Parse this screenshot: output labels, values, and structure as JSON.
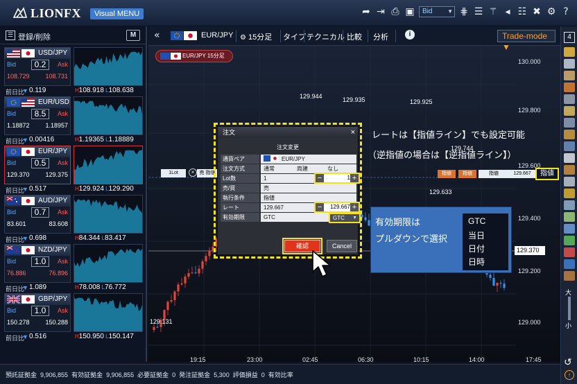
{
  "header": {
    "logo": "LIONFX",
    "visual_menu": "Visual MENU",
    "bid_select": "Bid"
  },
  "left_panel": {
    "register_label": "登録/削除",
    "m_button": "M",
    "change_label": "前日比",
    "pairs": [
      {
        "name": "USD/JPY",
        "bid_label": "Bid",
        "ask_label": "Ask",
        "spread": "0.2",
        "bid": "108.729",
        "ask": "108.731",
        "bid_color": "red",
        "ask_color": "red",
        "change": "0.119",
        "high": "108.918",
        "low": "108.638",
        "selected": false
      },
      {
        "name": "EUR/USD",
        "bid_label": "Bid",
        "ask_label": "Ask",
        "spread": "8.5",
        "bid": "1.18872",
        "ask": "1.18957",
        "bid_color": "white",
        "ask_color": "white",
        "change": "0.00416",
        "high": "1.19365",
        "low": "1.18889",
        "selected": false
      },
      {
        "name": "EUR/JPY",
        "bid_label": "Bid",
        "ask_label": "Ask",
        "spread": "0.5",
        "bid": "129.370",
        "ask": "129.375",
        "bid_color": "white",
        "ask_color": "white",
        "change": "0.517",
        "high": "129.924",
        "low": "129.290",
        "selected": true
      },
      {
        "name": "AUD/JPY",
        "bid_label": "Bid",
        "ask_label": "Ask",
        "spread": "0.7",
        "bid": "83.601",
        "ask": "83.608",
        "bid_color": "white",
        "ask_color": "white",
        "change": "0.698",
        "high": "84.344",
        "low": "83.417",
        "selected": false
      },
      {
        "name": "NZD/JPY",
        "bid_label": "Bid",
        "ask_label": "Ask",
        "spread": "1.0",
        "bid": "76.886",
        "ask": "76.896",
        "bid_color": "red",
        "ask_color": "red",
        "change": "1.089",
        "high": "78.008",
        "low": "76.772",
        "selected": false
      },
      {
        "name": "GBP/JPY",
        "bid_label": "Bid",
        "ask_label": "Ask",
        "spread": "1.0",
        "bid": "150.278",
        "ask": "150.288",
        "bid_color": "white",
        "ask_color": "white",
        "change": "0.516",
        "high": "150.950",
        "low": "150.147",
        "selected": false
      }
    ]
  },
  "chart_toolbar": {
    "pair": "EUR/JPY",
    "timeframe": "15分足",
    "type": "タイプ",
    "technical": "テクニカル",
    "compare": "比較",
    "analysis": "分析",
    "trade_mode": "Trade-mode ▼"
  },
  "chart_tag": "EUR/JPY 15分足",
  "y_axis": {
    "labels": [
      "130.000",
      "129.800",
      "129.600",
      "129.400",
      "129.200",
      "129.000"
    ],
    "current": "129.370"
  },
  "x_axis": [
    "19:15",
    "23:00",
    "02:45",
    "06:30",
    "10:15",
    "14:00",
    "17:45"
  ],
  "price_labels": [
    "129.944",
    "129.935",
    "129.925",
    "129.744",
    "129.633",
    "129.131"
  ],
  "order_line_labels": {
    "left": "1Lot",
    "mid": "売 指値",
    "right": "指値",
    "price": "129.667"
  },
  "dialog": {
    "title": "注文",
    "close": "×",
    "subtitle": "注文変更",
    "rows": [
      {
        "key": "通貨ペア",
        "value": "EUR/JPY"
      },
      {
        "key": "注文方式",
        "value": "通常",
        "value2": "両建",
        "value3": "なし"
      },
      {
        "key": "Lot数",
        "value": "1"
      },
      {
        "key": "売/買",
        "value": "売"
      },
      {
        "key": "執行条件",
        "value": "指値"
      },
      {
        "key": "レート",
        "value": "129.667"
      },
      {
        "key": "有効期限",
        "value": "GTC"
      }
    ],
    "lot_value": "1",
    "rate_value": "129.667",
    "expiry_select": "GTC",
    "confirm": "確認",
    "cancel": "Cancel"
  },
  "annotations": {
    "note1": "レートは【指値ライン】でも設定可能",
    "note2": "（逆指値の場合は【逆指値ライン】）",
    "sashine_badge": "指値",
    "blue_line1": "有効期限は",
    "blue_line2": "プルダウンで選択",
    "options": [
      "GTC",
      "当日",
      "日付",
      "日時"
    ]
  },
  "right_toolbar": {
    "top_number": "4",
    "zoom_big": "大",
    "zoom_small": "小"
  },
  "status_bar": {
    "items": [
      {
        "label": "預託証拠金",
        "value": "9,906,855"
      },
      {
        "label": "有効証拠金",
        "value": "9,906,855"
      },
      {
        "label": "必要証拠金",
        "value": "0"
      },
      {
        "label": "発注証拠金",
        "value": "5,300"
      },
      {
        "label": "評価損益",
        "value": "0"
      },
      {
        "label": "有効比率",
        "value": ""
      }
    ]
  },
  "colors": {
    "accent": "#f4e21a",
    "bid_blue": "#5aa5ff",
    "ask_red": "#ff5a5a",
    "confirm": "#e0341c",
    "annotation_box": "#3a6fba"
  }
}
